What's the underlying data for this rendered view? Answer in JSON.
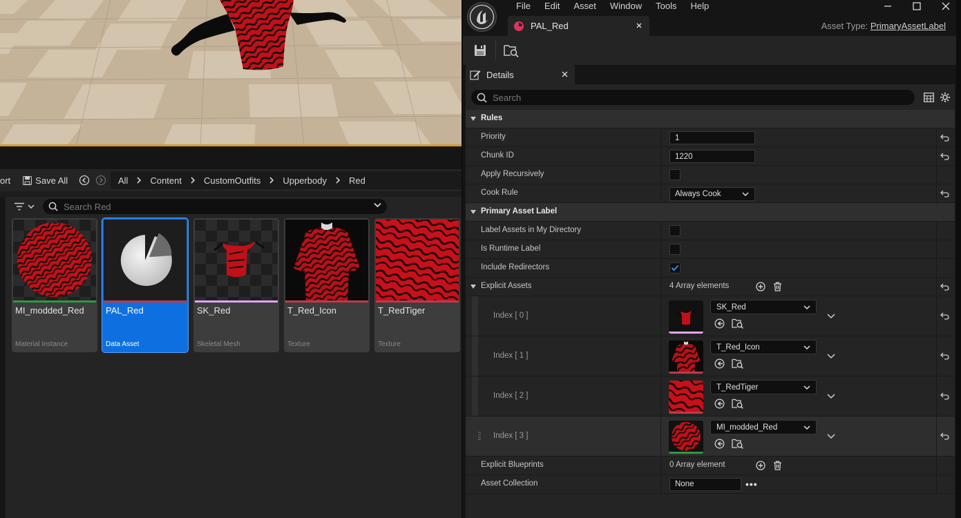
{
  "content_browser": {
    "toolbar": {
      "import_tail": "ort",
      "save_all_label": "Save All"
    },
    "breadcrumb": [
      "All",
      "Content",
      "CustomOutfits",
      "Upperbody",
      "Red"
    ],
    "search_placeholder": "Search Red",
    "tiles": [
      {
        "name": "MI_modded_Red",
        "type": "Material Instance",
        "bar_color": "#2e9a3e",
        "selected": false
      },
      {
        "name": "PAL_Red",
        "type": "Data Asset",
        "bar_color": "#c0394a",
        "selected": true
      },
      {
        "name": "SK_Red",
        "type": "Skeletal Mesh",
        "bar_color": "#e3a5f5",
        "selected": false
      },
      {
        "name": "T_Red_Icon",
        "type": "Texture",
        "bar_color": "#c0394a",
        "selected": false
      },
      {
        "name": "T_RedTiger",
        "type": "Texture",
        "bar_color": "#c0394a",
        "selected": false
      }
    ]
  },
  "editor": {
    "menu": [
      "File",
      "Edit",
      "Asset",
      "Window",
      "Tools",
      "Help"
    ],
    "tab_title": "PAL_Red",
    "asset_type_label": "Asset Type:",
    "asset_type_value": "PrimaryAssetLabel",
    "details": {
      "tab_label": "Details",
      "search_placeholder": "Search",
      "categories": {
        "rules": "Rules",
        "primary_asset_label": "Primary Asset Label"
      },
      "rules": {
        "priority_label": "Priority",
        "priority_value": "1",
        "chunk_id_label": "Chunk ID",
        "chunk_id_value": "1220",
        "apply_recursively_label": "Apply Recursively",
        "apply_recursively_checked": false,
        "cook_rule_label": "Cook Rule",
        "cook_rule_value": "Always Cook"
      },
      "label": {
        "label_assets_label": "Label Assets in My Directory",
        "label_assets_checked": false,
        "is_runtime_label": "Is Runtime Label",
        "is_runtime_checked": false,
        "include_redirectors_label": "Include Redirectors",
        "include_redirectors_checked": true,
        "explicit_assets_label": "Explicit Assets",
        "explicit_assets_count": "4 Array elements",
        "explicit_assets": [
          {
            "index": "Index [ 0 ]",
            "asset": "SK_Red",
            "bar_color": "#e3a5f5"
          },
          {
            "index": "Index [ 1 ]",
            "asset": "T_Red_Icon",
            "bar_color": "#c0394a"
          },
          {
            "index": "Index [ 2 ]",
            "asset": "T_RedTiger",
            "bar_color": "#c0394a"
          },
          {
            "index": "Index [ 3 ]",
            "asset": "MI_modded_Red",
            "bar_color": "#2e9a3e"
          }
        ],
        "explicit_blueprints_label": "Explicit Blueprints",
        "explicit_blueprints_count": "0 Array element",
        "asset_collection_label": "Asset Collection",
        "asset_collection_value": "None"
      }
    }
  },
  "colors": {
    "accent_blue": "#0e70e0",
    "viewport_border": "#d49a2a",
    "asset_tab_icon": "#d8345f"
  }
}
